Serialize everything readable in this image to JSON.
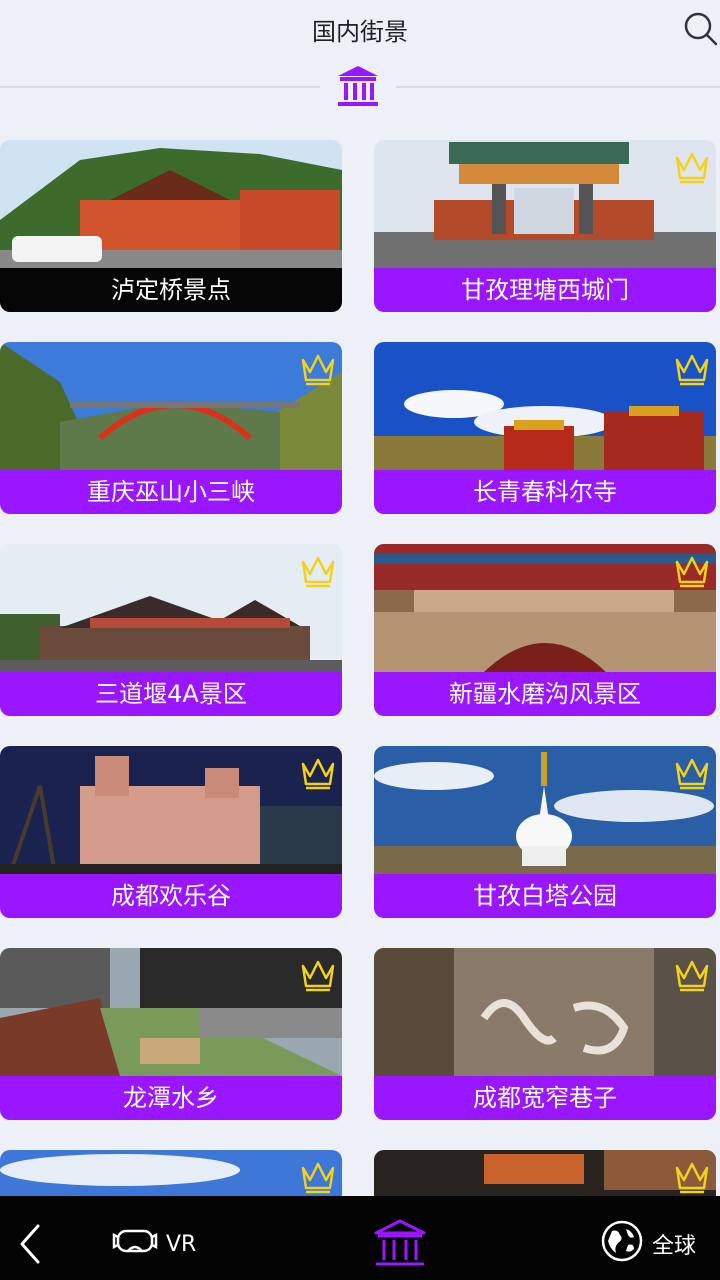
{
  "header": {
    "title": "国内街景",
    "search_icon": "search-icon",
    "category_icon": "museum-icon"
  },
  "colors": {
    "accent": "#9a16ff",
    "crown": "#f3d21a",
    "background": "#eef0f8",
    "bottom_bar": "#040404"
  },
  "cards": [
    {
      "label": "泸定桥景点",
      "premium": false
    },
    {
      "label": "甘孜理塘西城门",
      "premium": true
    },
    {
      "label": "重庆巫山小三峡",
      "premium": true
    },
    {
      "label": "长青春科尔寺",
      "premium": true
    },
    {
      "label": "三道堰4A景区",
      "premium": true
    },
    {
      "label": "新疆水磨沟风景区",
      "premium": true
    },
    {
      "label": "成都欢乐谷",
      "premium": true
    },
    {
      "label": "甘孜白塔公园",
      "premium": true
    },
    {
      "label": "龙潭水乡",
      "premium": true
    },
    {
      "label": "成都宽窄巷子",
      "premium": true
    }
  ],
  "bottom_nav": {
    "back_icon": "back-chevron-icon",
    "vr_label": "VR",
    "vr_icon": "vr-headset-icon",
    "center_icon": "museum-icon",
    "global_label": "全球",
    "global_icon": "globe-icon"
  }
}
